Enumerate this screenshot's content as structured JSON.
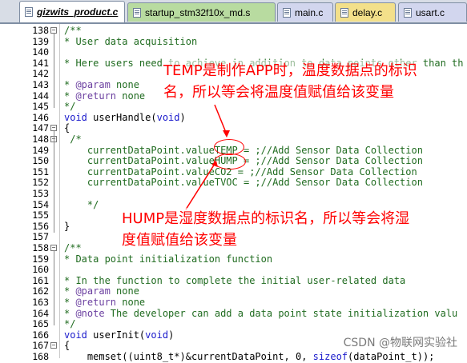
{
  "tabs": [
    {
      "label": "gizwits_product.c",
      "active": true
    },
    {
      "label": "startup_stm32f10x_md.s",
      "active": false
    },
    {
      "label": "main.c",
      "active": false
    },
    {
      "label": "delay.c",
      "active": false
    },
    {
      "label": "usart.c",
      "active": false
    }
  ],
  "lines": [
    {
      "num": "138",
      "fold": "−",
      "text": "/**"
    },
    {
      "num": "139",
      "fold": "",
      "text": "* User data acquisition"
    },
    {
      "num": "140",
      "fold": "",
      "text": ""
    },
    {
      "num": "141",
      "fold": "",
      "text": "* Here users need to achieve in addition to data points other than th"
    },
    {
      "num": "142",
      "fold": "",
      "text": ""
    },
    {
      "num": "143",
      "fold": "",
      "text": "* @param none"
    },
    {
      "num": "144",
      "fold": "",
      "text": "* @return none"
    },
    {
      "num": "145",
      "fold": "",
      "text": "*/"
    },
    {
      "num": "146",
      "fold": "",
      "text": "void userHandle(void)"
    },
    {
      "num": "147",
      "fold": "−",
      "text": "{"
    },
    {
      "num": "148",
      "fold": "−",
      "text": " /*"
    },
    {
      "num": "149",
      "fold": "",
      "text": "    currentDataPoint.valueTEMP = ;//Add Sensor Data Collection"
    },
    {
      "num": "150",
      "fold": "",
      "text": "    currentDataPoint.valueHUMP = ;//Add Sensor Data Collection"
    },
    {
      "num": "151",
      "fold": "",
      "text": "    currentDataPoint.valueCO2 = ;//Add Sensor Data Collection"
    },
    {
      "num": "152",
      "fold": "",
      "text": "    currentDataPoint.valueTVOC = ;//Add Sensor Data Collection"
    },
    {
      "num": "153",
      "fold": "",
      "text": ""
    },
    {
      "num": "154",
      "fold": "",
      "text": "    */"
    },
    {
      "num": "155",
      "fold": "",
      "text": ""
    },
    {
      "num": "156",
      "fold": "",
      "text": "}"
    },
    {
      "num": "157",
      "fold": "",
      "text": ""
    },
    {
      "num": "158",
      "fold": "−",
      "text": "/**"
    },
    {
      "num": "159",
      "fold": "",
      "text": "* Data point initialization function"
    },
    {
      "num": "160",
      "fold": "",
      "text": ""
    },
    {
      "num": "161",
      "fold": "",
      "text": "* In the function to complete the initial user-related data"
    },
    {
      "num": "162",
      "fold": "",
      "text": "* @param none"
    },
    {
      "num": "163",
      "fold": "",
      "text": "* @return none"
    },
    {
      "num": "164",
      "fold": "",
      "text": "* @note The developer can add a data point state initialization valu"
    },
    {
      "num": "165",
      "fold": "",
      "text": "*/"
    },
    {
      "num": "166",
      "fold": "",
      "text": "void userInit(void)"
    },
    {
      "num": "167",
      "fold": "−",
      "text": "{"
    },
    {
      "num": "168",
      "fold": "",
      "text": "    memset((uint8_t*)&currentDataPoint, 0, sizeof(dataPoint_t));"
    }
  ],
  "annotations": {
    "temp_note_line1": "TEMP是制作APP时，温度数据点的标识",
    "temp_note_line2": "名，所以等会将温度值赋值给该变量",
    "hump_note_line1": "HUMP是湿度数据点的标识名，所以等会将湿",
    "hump_note_line2": "度值赋值给该变量"
  },
  "watermark": "CSDN @物联网实验社",
  "colors": {
    "comment": "#1f6b1f",
    "keyword": "#1a1acc",
    "annotation": "#ff0000"
  }
}
